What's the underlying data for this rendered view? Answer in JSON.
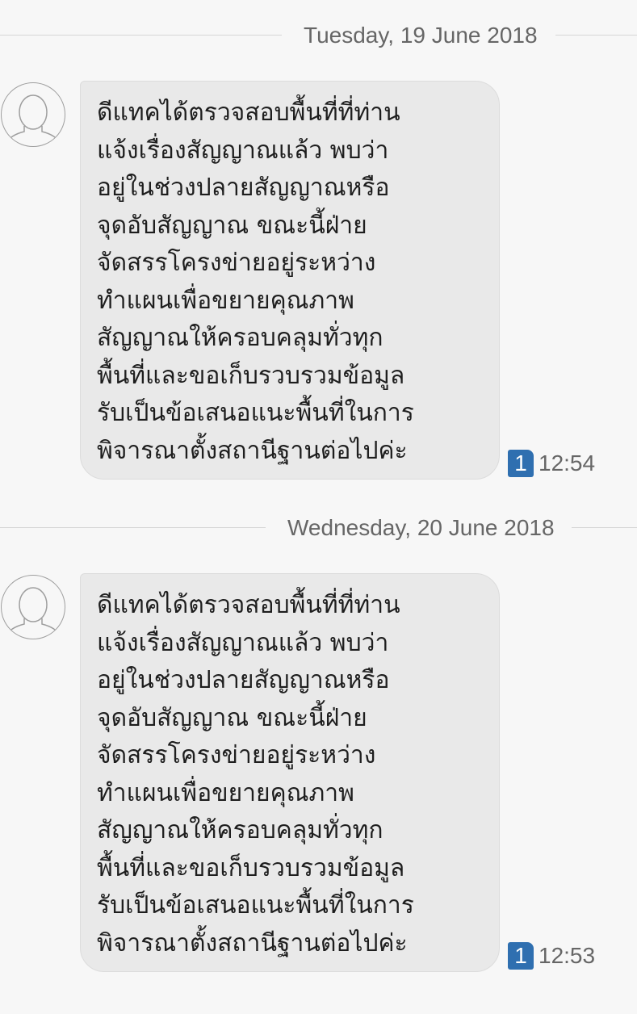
{
  "conversation": [
    {
      "date": "Tuesday, 19 June 2018",
      "message": {
        "lines": [
          "ดีแทคได้ตรวจสอบพื้นที่ที่ท่าน",
          "แจ้งเรื่องสัญญาณแล้ว พบว่า",
          "อยู่ในช่วงปลายสัญญาณหรือ",
          "จุดอับสัญญาณ ขณะนี้ฝ่าย",
          "จัดสรรโครงข่ายอยู่ระหว่าง",
          "ทำแผนเพื่อขยายคุณภาพ",
          "สัญญาณให้ครอบคลุมทั่วทุก",
          "พื้นที่และขอเก็บรวบรวมข้อมูล",
          "รับเป็นข้อเสนอแนะพื้นที่ในการ",
          "พิจารณาตั้งสถานีฐานต่อไปค่ะ"
        ],
        "sim": "1",
        "time": "12:54"
      }
    },
    {
      "date": "Wednesday, 20 June 2018",
      "message": {
        "lines": [
          "ดีแทคได้ตรวจสอบพื้นที่ที่ท่าน",
          "แจ้งเรื่องสัญญาณแล้ว พบว่า",
          "อยู่ในช่วงปลายสัญญาณหรือ",
          "จุดอับสัญญาณ ขณะนี้ฝ่าย",
          "จัดสรรโครงข่ายอยู่ระหว่าง",
          "ทำแผนเพื่อขยายคุณภาพ",
          "สัญญาณให้ครอบคลุมทั่วทุก",
          "พื้นที่และขอเก็บรวบรวมข้อมูล",
          "รับเป็นข้อเสนอแนะพื้นที่ในการ",
          "พิจารณาตั้งสถานีฐานต่อไปค่ะ"
        ],
        "sim": "1",
        "time": "12:53"
      }
    }
  ],
  "colors": {
    "background": "#f7f7f7",
    "bubble": "#e9e9e9",
    "sim_badge": "#2f6fb0",
    "meta_text": "#666666"
  },
  "icons": {
    "avatar": "default-contact-avatar-icon",
    "sim": "sim-1-badge-icon"
  }
}
